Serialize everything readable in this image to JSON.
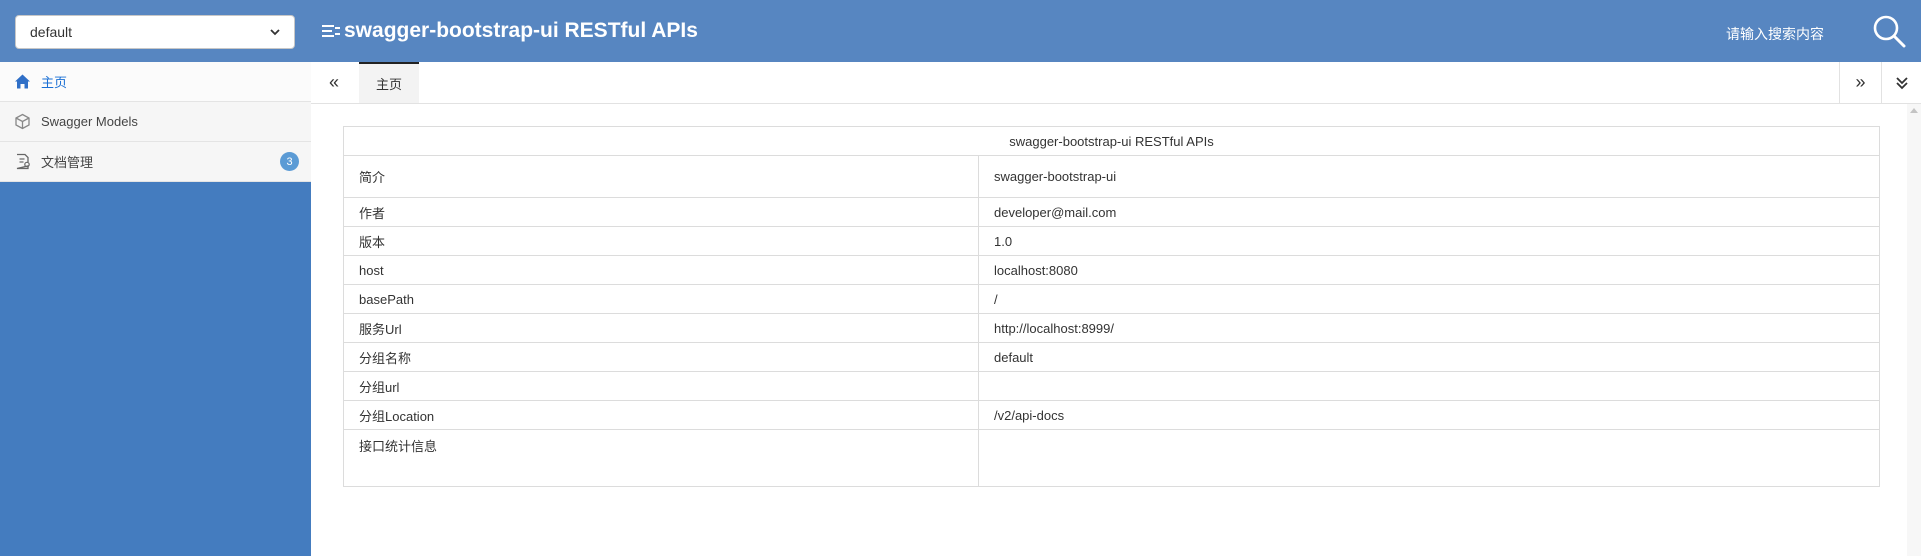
{
  "header": {
    "group_select_value": "default",
    "title": "swagger-bootstrap-ui RESTful APIs",
    "search_placeholder": "请输入搜索内容",
    "bg_color": "#5786c1"
  },
  "sidebar": {
    "bg_color": "#447cbf",
    "items": [
      {
        "label": "主页",
        "icon": "home-icon",
        "active": true
      },
      {
        "label": "Swagger Models",
        "icon": "models-icon"
      },
      {
        "label": "文档管理",
        "icon": "document-settings-icon",
        "badge": "3"
      }
    ]
  },
  "tabs": {
    "prev_label": "«",
    "home_label": "主页",
    "next_label": "»"
  },
  "info": {
    "title": "swagger-bootstrap-ui RESTful APIs",
    "rows": [
      {
        "key": "简介",
        "value": "swagger-bootstrap-ui"
      },
      {
        "key": "作者",
        "value": "developer@mail.com"
      },
      {
        "key": "版本",
        "value": "1.0"
      },
      {
        "key": "host",
        "value": "localhost:8080"
      },
      {
        "key": "basePath",
        "value": "/"
      },
      {
        "key": "服务Url",
        "value": "http://localhost:8999/"
      },
      {
        "key": "分组名称",
        "value": "default"
      },
      {
        "key": "分组url",
        "value": ""
      },
      {
        "key": "分组Location",
        "value": "/v2/api-docs"
      },
      {
        "key": "接口统计信息",
        "value": ""
      }
    ]
  }
}
